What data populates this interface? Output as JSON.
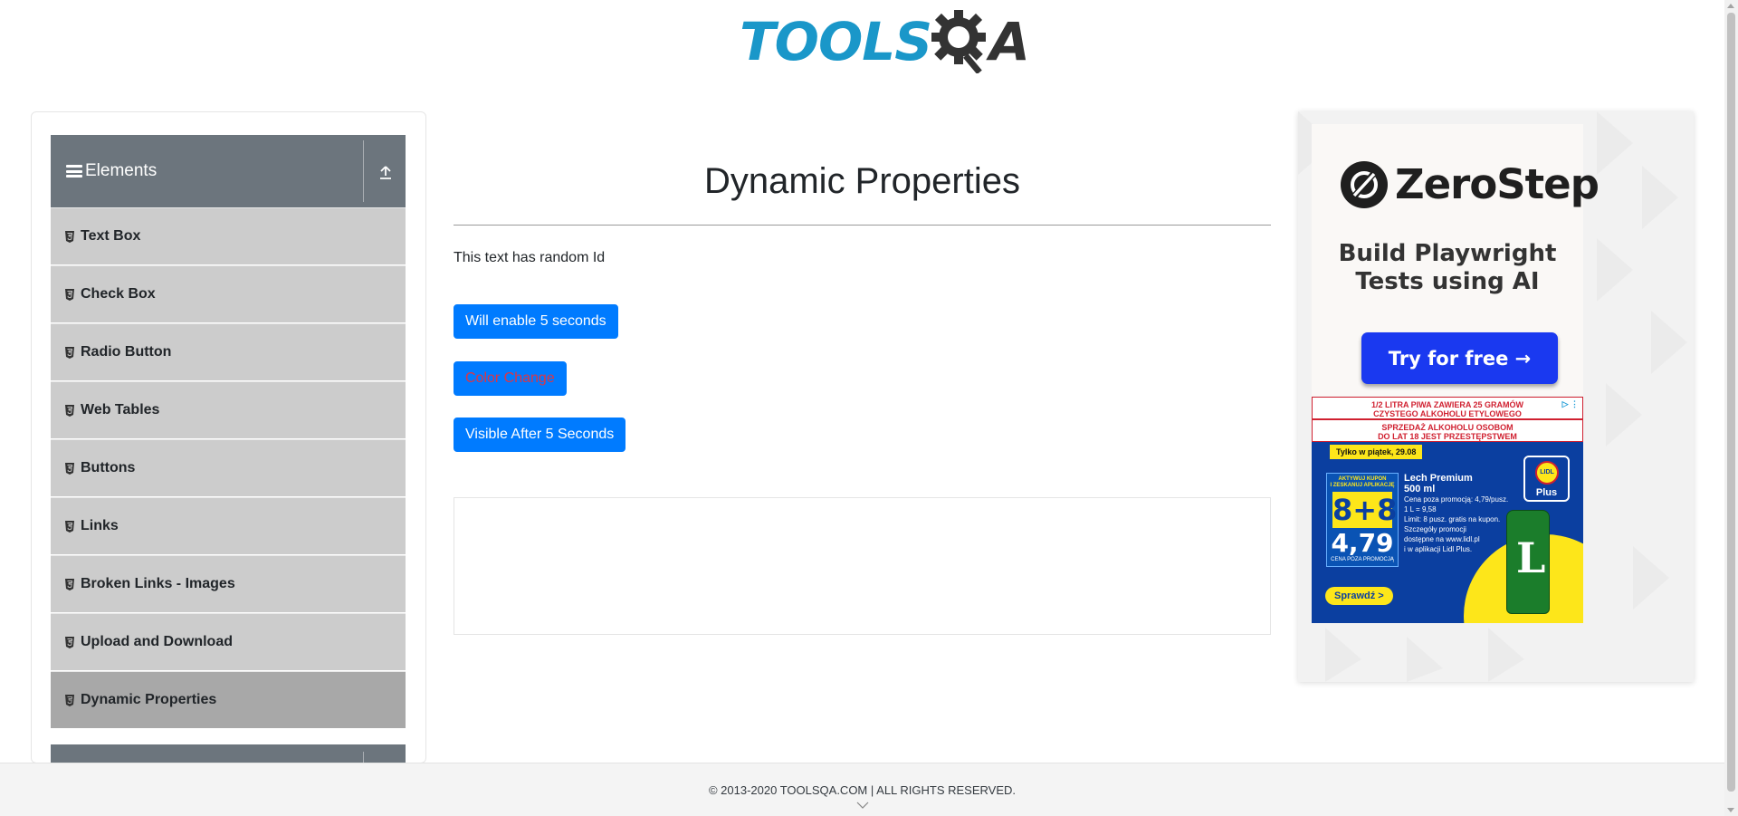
{
  "header": {
    "logo_left": "TOOLS",
    "logo_right": "A"
  },
  "sidebar": {
    "group_title": "Elements",
    "items": [
      {
        "label": "Text Box"
      },
      {
        "label": "Check Box"
      },
      {
        "label": "Radio Button"
      },
      {
        "label": "Web Tables"
      },
      {
        "label": "Buttons"
      },
      {
        "label": "Links"
      },
      {
        "label": "Broken Links - Images"
      },
      {
        "label": "Upload and Download"
      },
      {
        "label": "Dynamic Properties"
      }
    ],
    "active_item": "Dynamic Properties"
  },
  "main": {
    "title": "Dynamic Properties",
    "random_id_text": "This text has random Id",
    "enable_button": "Will enable 5 seconds",
    "color_change_button": "Color Change",
    "visible_after_button": "Visible After 5 Seconds"
  },
  "ad_right": {
    "brand": "ZeroStep",
    "tagline_line1": "Build Playwright",
    "tagline_line2": "Tests using AI",
    "cta": "Try for free →",
    "lidl": {
      "warning1_line1": "1/2 LITRA PIWA ZAWIERA 25 GRAMÓW",
      "warning1_line2": "CZYSTEGO ALKOHOLU ETYLOWEGO",
      "warning2_line1": "SPRZEDAŻ ALKOHOLU OSOBOM",
      "warning2_line2": "DO LAT 18 JEST PRZESTĘPSTWEM",
      "date_badge": "Tylko w piątek, 29.08",
      "coupon_header_line1": "AKTYWUJ KUPON",
      "coupon_header_line2": "I ZESKANUJ APLIKACJĘ",
      "offer": "8+8",
      "price": "4,79",
      "price_label": "CENA POZA PROMOCJĄ",
      "product_name": "Lech Premium",
      "product_size": "500 ml",
      "product_details": [
        "Cena poza promocją: 4,79/pusz.",
        "1 L = 9,58",
        "Limit: 8 pusz. gratis na kupon.",
        "Szczegóły promocji",
        "dostępne na www.lidl.pl",
        "i w aplikacji Lidl Plus."
      ],
      "logo_plus": "Plus",
      "logo_text": "LIDL",
      "cta": "Sprawdź >",
      "can_letter": "L"
    }
  },
  "footer": {
    "copyright": "© 2013-2020 TOOLSQA.COM | ALL RIGHTS RESERVED."
  },
  "colors": {
    "primary_button": "#007bff",
    "sidebar_header": "#6c757d",
    "menu_item": "#cccccc",
    "menu_active": "#a8a8a8",
    "color_change_text": "#dc3545",
    "zerostep_cta": "#1a39f0"
  }
}
